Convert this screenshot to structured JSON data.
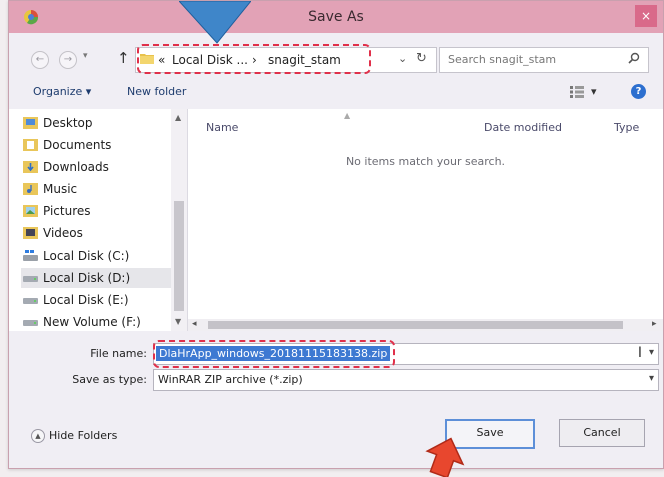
{
  "window": {
    "title": "Save As",
    "close_label": "×"
  },
  "nav": {
    "back": "←",
    "forward": "→",
    "up": "↑",
    "breadcrumb": [
      "«",
      "Local Disk ...",
      "›",
      "snagit_stam"
    ],
    "address_dropdown": "⌄",
    "refresh": "↻",
    "search_placeholder": "Search snagit_stam"
  },
  "toolbar": {
    "organize": "Organize ▾",
    "new_folder": "New folder",
    "view_dropdown": "▾",
    "help": "?"
  },
  "sidebar": {
    "items": [
      {
        "label": "Desktop",
        "icon": "desktop-folder-icon"
      },
      {
        "label": "Documents",
        "icon": "documents-folder-icon"
      },
      {
        "label": "Downloads",
        "icon": "downloads-folder-icon"
      },
      {
        "label": "Music",
        "icon": "music-folder-icon"
      },
      {
        "label": "Pictures",
        "icon": "pictures-folder-icon"
      },
      {
        "label": "Videos",
        "icon": "videos-folder-icon"
      },
      {
        "label": "Local Disk (C:)",
        "icon": "windows-drive-icon"
      },
      {
        "label": "Local Disk (D:)",
        "icon": "drive-icon",
        "selected": true
      },
      {
        "label": "Local Disk (E:)",
        "icon": "drive-icon"
      },
      {
        "label": "New Volume (F:)",
        "icon": "drive-icon"
      }
    ]
  },
  "files": {
    "columns": [
      "Name",
      "Date modified",
      "Type"
    ],
    "empty_message": "No items match your search."
  },
  "form": {
    "file_name_label": "File name:",
    "file_name_value": "DlaHrApp_windows_20181115183138.zip",
    "save_as_type_label": "Save as type:",
    "save_as_type_value": "WinRAR ZIP archive (*.zip)"
  },
  "footer": {
    "hide_folders": "Hide Folders",
    "save": "Save",
    "cancel": "Cancel"
  },
  "colors": {
    "titlebar": "#e2a2b6",
    "highlight": "#e0304a",
    "selection": "#3d79d2",
    "callout": "#3f86c9"
  }
}
